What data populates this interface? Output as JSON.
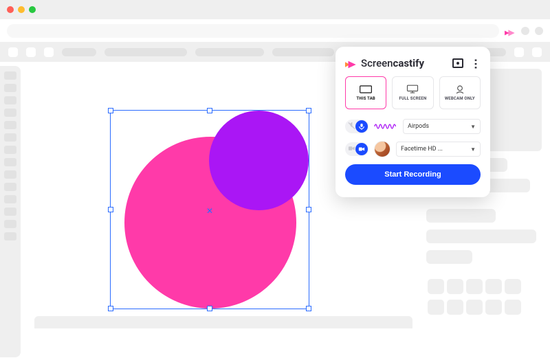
{
  "chrome": {
    "traffic_lights": [
      "close",
      "minimize",
      "zoom"
    ]
  },
  "brand": {
    "name_prefix": "Screen",
    "name_bold": "castify"
  },
  "modes": {
    "tab": {
      "label": "THIS TAB",
      "active": true
    },
    "full": {
      "label": "FULL SCREEN",
      "active": false
    },
    "webcam": {
      "label": "WEBCAM ONLY",
      "active": false
    }
  },
  "audio": {
    "enabled": true,
    "device_label": "Airpods"
  },
  "video": {
    "enabled": true,
    "device_label": "Facetime HD ..."
  },
  "record_button_label": "Start Recording",
  "colors": {
    "brand_pink": "#ff3aa9",
    "brand_purple": "#aa16f5",
    "primary_blue": "#1b4bff"
  }
}
